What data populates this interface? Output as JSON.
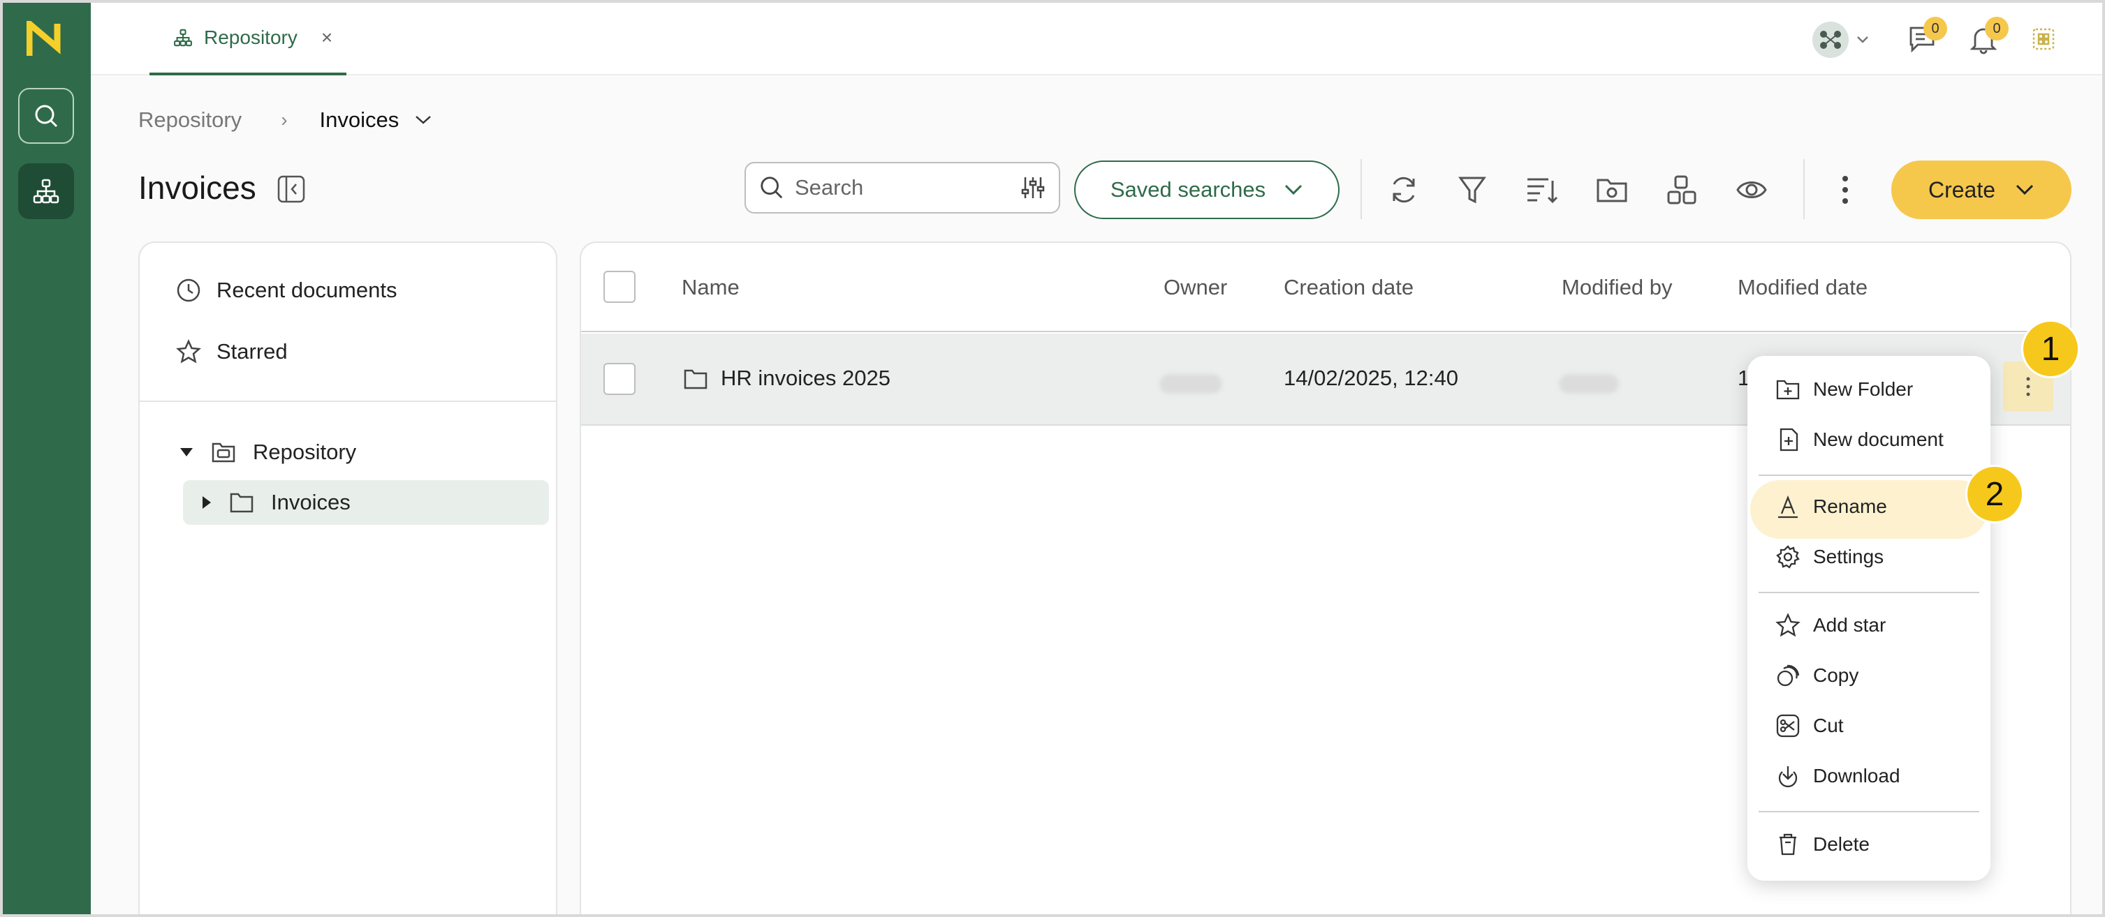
{
  "app": {
    "tab_label": "Repository",
    "tab_close": "×",
    "message_count": "0",
    "notification_count": "0"
  },
  "breadcrumb": {
    "root": "Repository",
    "separator": "›",
    "current": "Invoices"
  },
  "page": {
    "title": "Invoices"
  },
  "toolbar": {
    "search_placeholder": "Search",
    "saved_searches_label": "Saved searches",
    "create_label": "Create"
  },
  "sidebar": {
    "recent_label": "Recent documents",
    "starred_label": "Starred",
    "tree_root": "Repository",
    "tree_child": "Invoices"
  },
  "table": {
    "headers": {
      "name": "Name",
      "owner": "Owner",
      "creation_date": "Creation date",
      "modified_by": "Modified by",
      "modified_date": "Modified date"
    },
    "rows": [
      {
        "name": "HR invoices 2025",
        "creation_date": "14/02/2025, 12:40",
        "modified_date_partial": "1"
      }
    ]
  },
  "context_menu": {
    "items": [
      {
        "label": "New Folder",
        "icon": "folder-plus-icon"
      },
      {
        "label": "New document",
        "icon": "document-plus-icon"
      },
      {
        "label": "Rename",
        "icon": "rename-icon"
      },
      {
        "label": "Settings",
        "icon": "gear-icon"
      },
      {
        "label": "Add star",
        "icon": "star-icon"
      },
      {
        "label": "Copy",
        "icon": "copy-icon"
      },
      {
        "label": "Cut",
        "icon": "scissors-icon"
      },
      {
        "label": "Download",
        "icon": "download-icon"
      },
      {
        "label": "Delete",
        "icon": "trash-icon"
      }
    ]
  },
  "steps": {
    "one": "1",
    "two": "2"
  },
  "colors": {
    "brand_green": "#2f6b4a",
    "accent_yellow": "#f5c84c",
    "highlight": "#fdf1cf"
  }
}
